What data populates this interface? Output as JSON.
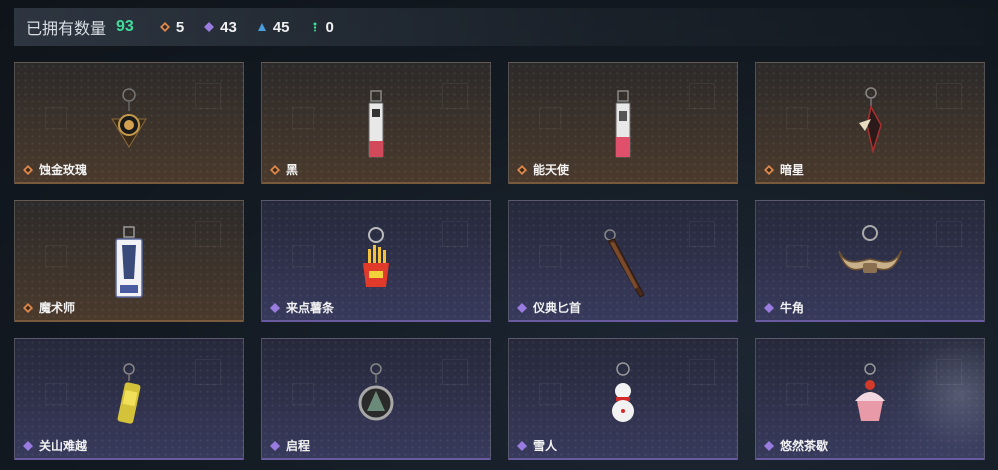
{
  "header": {
    "owned_label": "已拥有数量",
    "owned_count": "93",
    "stats": [
      {
        "icon": "gold-diamond-icon",
        "color": "#e0884a",
        "value": "5"
      },
      {
        "icon": "purple-diamond-icon",
        "color": "#9a7be0",
        "value": "43"
      },
      {
        "icon": "blue-triangle-icon",
        "color": "#4a9ee0",
        "value": "45"
      },
      {
        "icon": "green-dots-icon",
        "color": "#3fdc9a",
        "value": "0"
      }
    ]
  },
  "items": [
    {
      "name": "蚀金玫瑰",
      "rarity": "gold"
    },
    {
      "name": "黑",
      "rarity": "gold"
    },
    {
      "name": "能天使",
      "rarity": "gold"
    },
    {
      "name": "暗星",
      "rarity": "gold"
    },
    {
      "name": "魔术师",
      "rarity": "gold"
    },
    {
      "name": "来点薯条",
      "rarity": "purple"
    },
    {
      "name": "仪典匕首",
      "rarity": "purple"
    },
    {
      "name": "牛角",
      "rarity": "purple"
    },
    {
      "name": "关山难越",
      "rarity": "purple"
    },
    {
      "name": "启程",
      "rarity": "purple"
    },
    {
      "name": "雪人",
      "rarity": "purple"
    },
    {
      "name": "悠然茶歇",
      "rarity": "purple"
    }
  ],
  "colors": {
    "gold_rarity": "#e0884a",
    "purple_rarity": "#9a7be0",
    "count_green": "#3fdc9a"
  }
}
